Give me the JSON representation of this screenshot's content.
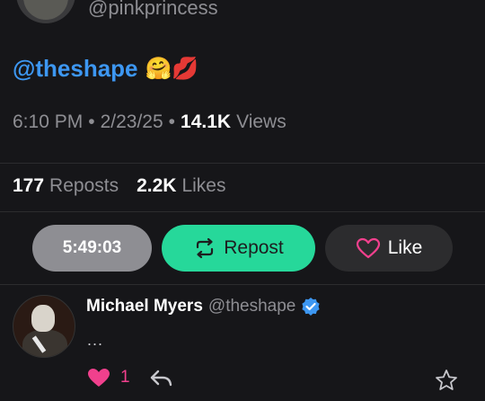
{
  "top_tweet": {
    "handle": "@pinkprincess",
    "text_mention": "@theshape",
    "emojis": "🤗💋",
    "time": "6:10 PM",
    "date": "2/23/25",
    "views_count": "14.1K",
    "views_label": "Views",
    "reposts_count": "177",
    "reposts_label": "Reposts",
    "likes_count": "2.2K",
    "likes_label": "Likes"
  },
  "actions": {
    "timer": "5:49:03",
    "repost_label": "Repost",
    "like_label": "Like",
    "repost_color": "#26d89a"
  },
  "reply": {
    "name": "Michael Myers",
    "handle": "@theshape",
    "text": "...",
    "like_count": "1"
  },
  "colors": {
    "background": "#161619",
    "mention": "#3d97f2",
    "verified": "#3d97f2",
    "like": "#f1408d"
  }
}
